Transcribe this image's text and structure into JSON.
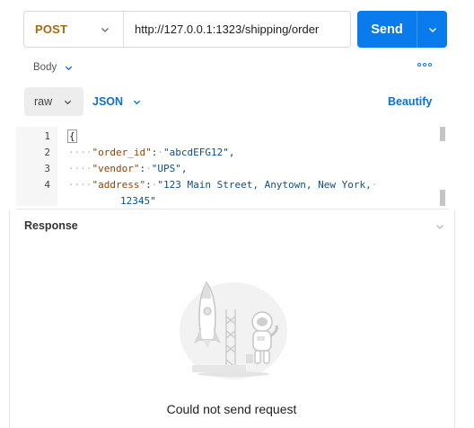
{
  "request": {
    "method": "POST",
    "url": "http://127.0.0.1:1323/shipping/order",
    "send_label": "Send"
  },
  "tabs": {
    "body_label": "Body"
  },
  "body": {
    "mode_label": "raw",
    "format_label": "JSON",
    "beautify_label": "Beautify",
    "line_numbers": [
      "1",
      "2",
      "3",
      "4"
    ],
    "code": {
      "open_brace": "{",
      "line2_key": "\"order_id\"",
      "line2_val": "\"abcdEFG12\"",
      "line3_key": "\"vendor\"",
      "line3_val": "\"UPS\"",
      "line4_key": "\"address\"",
      "line4_val": "\"123 Main Street, Anytown, New York,",
      "line4_wrap": "12345\""
    }
  },
  "response": {
    "title": "Response",
    "empty_message": "Could not send request"
  },
  "icons": {
    "method_dropdown": "chevron-down-icon",
    "send_dropdown": "chevron-down-icon",
    "body_dropdown": "chevron-down-icon",
    "more": "more-options-icon",
    "raw_dropdown": "chevron-down-icon",
    "json_dropdown": "chevron-down-icon",
    "response_collapse": "chevron-down-icon",
    "illustration": "astronaut-rocket-illustration"
  },
  "colors": {
    "accent": "#097bed",
    "method": "#a5690e",
    "link": "#0b6fd6"
  }
}
